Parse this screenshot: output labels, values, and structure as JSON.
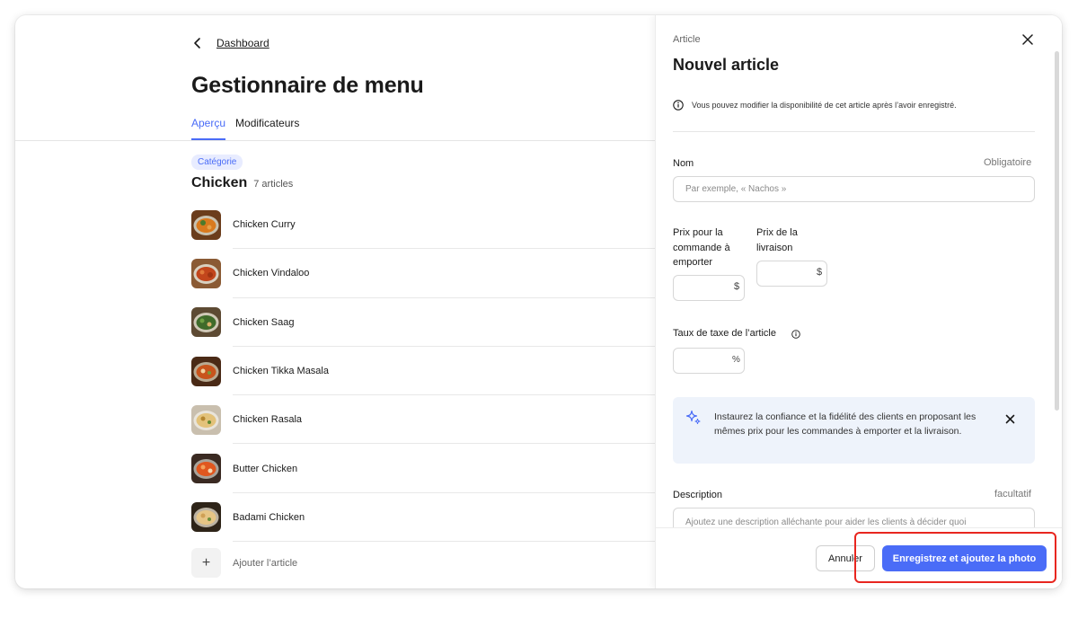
{
  "breadcrumb": {
    "back_label": "Dashboard"
  },
  "page": {
    "title": "Gestionnaire de menu"
  },
  "tabs": [
    {
      "label": "Aperçu",
      "active": true
    },
    {
      "label": "Modificateurs",
      "active": false
    }
  ],
  "category": {
    "badge": "Catégorie",
    "name": "Chicken",
    "count": "7 articles",
    "items": [
      {
        "label": "Chicken Curry",
        "icon": "curry-dish-photo"
      },
      {
        "label": "Chicken Vindaloo",
        "icon": "vindaloo-dish-photo"
      },
      {
        "label": "Chicken Saag",
        "icon": "saag-dish-photo"
      },
      {
        "label": "Chicken Tikka Masala",
        "icon": "tikka-masala-dish-photo"
      },
      {
        "label": "Chicken Rasala",
        "icon": "rasala-dish-photo"
      },
      {
        "label": "Butter Chicken",
        "icon": "butter-chicken-dish-photo"
      },
      {
        "label": "Badami Chicken",
        "icon": "badami-chicken-dish-photo"
      }
    ],
    "add_item_label": "Ajouter l’article"
  },
  "panel": {
    "eyebrow": "Article",
    "title": "Nouvel article",
    "info_text": "Vous pouvez modifier la disponibilité de cet article après l’avoir enregistré.",
    "name_label": "Nom",
    "name_required": "Obligatoire",
    "name_placeholder": "Par exemple, « Nachos »",
    "pickup_price_label": "Prix pour la commande à emporter",
    "delivery_price_label": "Prix de la livraison",
    "currency_suffix": "$",
    "tax_label": "Taux de taxe de l’article",
    "percent_suffix": "%",
    "tip_text": "Instaurez la confiance et la fidélité des clients en proposant les mêmes prix pour les commandes à emporter et la livraison.",
    "description_label": "Description",
    "description_optional": "facultatif",
    "description_placeholder": "Ajoutez une description alléchante pour aider les clients à décider quoi",
    "cancel_label": "Annuler",
    "save_label": "Enregistrez et ajoutez la photo"
  },
  "colors": {
    "accent": "#4a6cf7",
    "highlight": "#e8261f",
    "tip_background": "#eef3fb"
  }
}
